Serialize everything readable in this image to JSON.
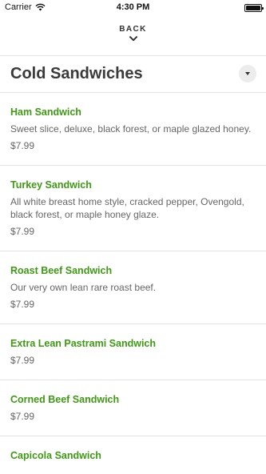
{
  "status_bar": {
    "carrier": "Carrier",
    "time": "4:30 PM"
  },
  "nav": {
    "back_label": "BACK"
  },
  "section": {
    "title": "Cold Sandwiches"
  },
  "items": [
    {
      "name": "Ham Sandwich",
      "description": "Sweet slice, deluxe, black forest, or maple glazed honey.",
      "price": "$7.99"
    },
    {
      "name": "Turkey Sandwich",
      "description": "All white breast home style, cracked pepper, Ovengold, black forest, or maple honey glaze.",
      "price": "$7.99"
    },
    {
      "name": "Roast Beef Sandwich",
      "description": "Our very own lean rare roast beef.",
      "price": "$7.99"
    },
    {
      "name": "Extra Lean Pastrami Sandwich",
      "description": "",
      "price": "$7.99"
    },
    {
      "name": "Corned Beef Sandwich",
      "description": "",
      "price": "$7.99"
    },
    {
      "name": "Capicola Sandwich",
      "description": "",
      "price": ""
    }
  ],
  "colors": {
    "accent_green": "#3d9a12",
    "divider": "#e3e3e3"
  }
}
